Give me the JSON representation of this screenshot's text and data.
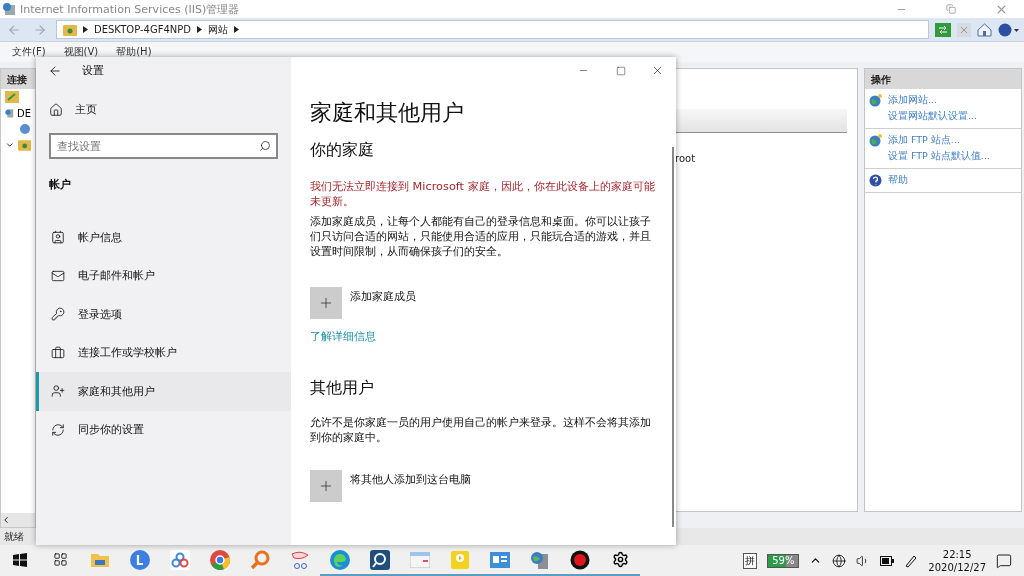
{
  "iis": {
    "title": "Internet Information Services (IIS)管理器",
    "breadcrumb": [
      "DESKTOP-4GF4NPD",
      "网站"
    ],
    "menu": [
      "文件(F)",
      "视图(V)",
      "帮助(H)"
    ],
    "connections": {
      "header": "连接",
      "tree_root": "DE"
    },
    "content": {
      "cell": "root"
    },
    "actions": {
      "header": "操作",
      "groups": [
        [
          "添加网站...",
          "设置网站默认设置..."
        ],
        [
          "添加 FTP 站点...",
          "设置 FTP 站点默认值..."
        ],
        [
          "帮助"
        ]
      ]
    },
    "status": "就绪"
  },
  "settings": {
    "title": "设置",
    "home": "主页",
    "search": {
      "placeholder": "查找设置"
    },
    "section": "帐户",
    "nav": [
      {
        "label": "帐户信息",
        "selected": false
      },
      {
        "label": "电子邮件和帐户",
        "selected": false
      },
      {
        "label": "登录选项",
        "selected": false
      },
      {
        "label": "连接工作或学校帐户",
        "selected": false
      },
      {
        "label": "家庭和其他用户",
        "selected": true
      },
      {
        "label": "同步你的设置",
        "selected": false
      }
    ],
    "page": {
      "title": "家庭和其他用户",
      "family": {
        "heading": "你的家庭",
        "error": "我们无法立即连接到 Microsoft 家庭，因此，你在此设备上的家庭可能未更新。",
        "description": "添加家庭成员，让每个人都能有自己的登录信息和桌面。你可以让孩子们只访问合适的网站，只能使用合适的应用，只能玩合适的游戏，并且设置时间限制，从而确保孩子们的安全。",
        "add": "添加家庭成员",
        "link": "了解详细信息"
      },
      "others": {
        "heading": "其他用户",
        "description": "允许不是你家庭一员的用户使用自己的帐户来登录。这样不会将其添加到你的家庭中。",
        "add": "将其他人添加到这台电脑"
      }
    }
  },
  "taskbar": {
    "ime": "拼",
    "battery": "59%",
    "time": "22:15",
    "date": "2020/12/27"
  }
}
